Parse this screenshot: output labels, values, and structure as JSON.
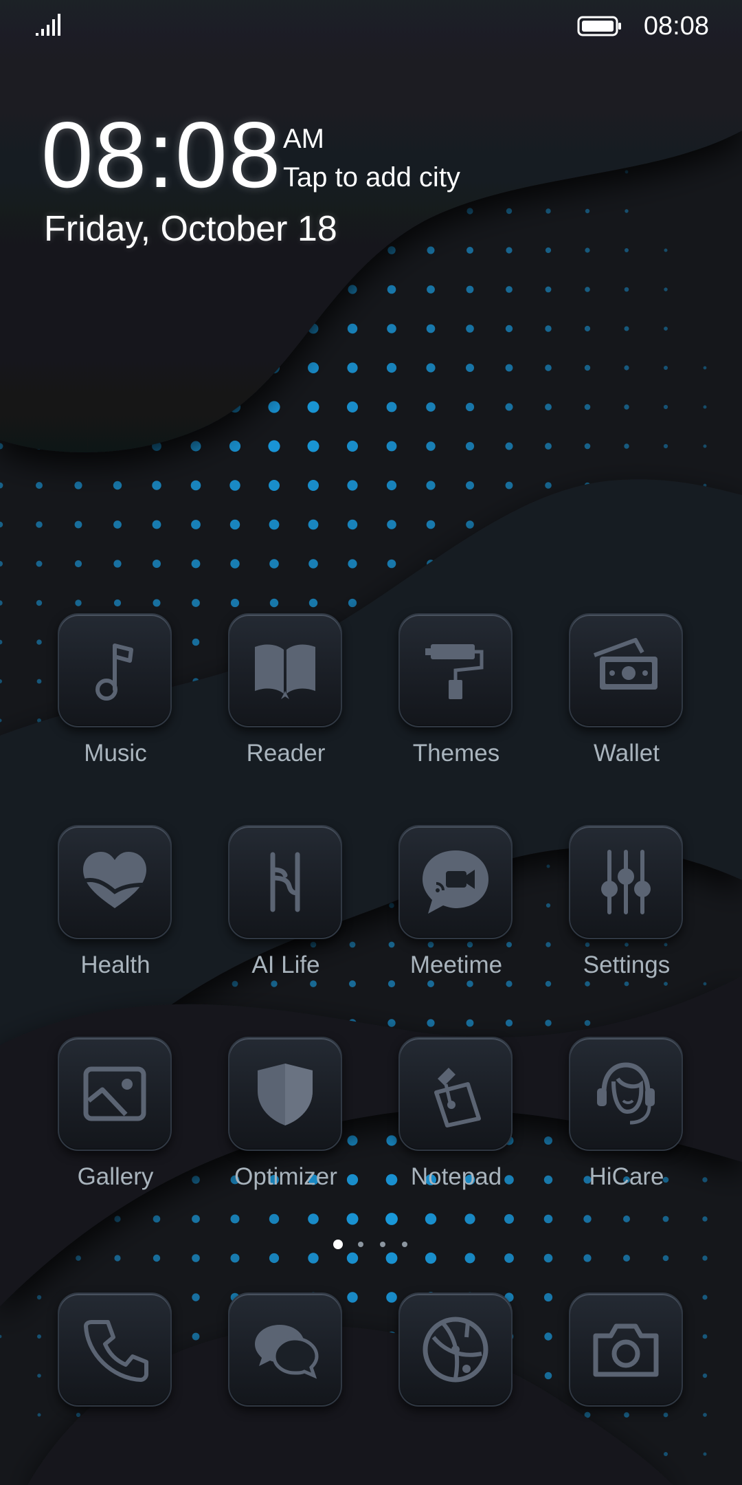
{
  "status_bar": {
    "time": "08:08",
    "signal_icon": "signal-bars-icon",
    "battery_icon": "battery-full-icon"
  },
  "clock_widget": {
    "time": "08:08",
    "ampm": "AM",
    "city_prompt": "Tap to add city",
    "date": "Friday, October 18"
  },
  "home_apps": [
    {
      "label": "Music",
      "icon": "music-note-icon"
    },
    {
      "label": "Reader",
      "icon": "book-icon"
    },
    {
      "label": "Themes",
      "icon": "paint-roller-icon"
    },
    {
      "label": "Wallet",
      "icon": "wallet-cash-icon"
    },
    {
      "label": "Health",
      "icon": "heart-icon"
    },
    {
      "label": "AI Life",
      "icon": "ai-life-icon"
    },
    {
      "label": "Meetime",
      "icon": "video-chat-icon"
    },
    {
      "label": "Settings",
      "icon": "sliders-icon"
    },
    {
      "label": "Gallery",
      "icon": "image-icon"
    },
    {
      "label": "Optimizer",
      "icon": "shield-icon"
    },
    {
      "label": "Notepad",
      "icon": "notepad-icon"
    },
    {
      "label": "HiCare",
      "icon": "headset-support-icon"
    }
  ],
  "page_indicator": {
    "page_count": 4,
    "active_page": 1
  },
  "dock_apps": [
    {
      "icon": "phone-icon"
    },
    {
      "icon": "messages-icon"
    },
    {
      "icon": "browser-icon"
    },
    {
      "icon": "camera-icon"
    }
  ],
  "colors": {
    "background": "#15171b",
    "accent_dots": "#1aa0e6",
    "icon_glyph": "#5b6473",
    "label_text": "#a9b4bd"
  }
}
